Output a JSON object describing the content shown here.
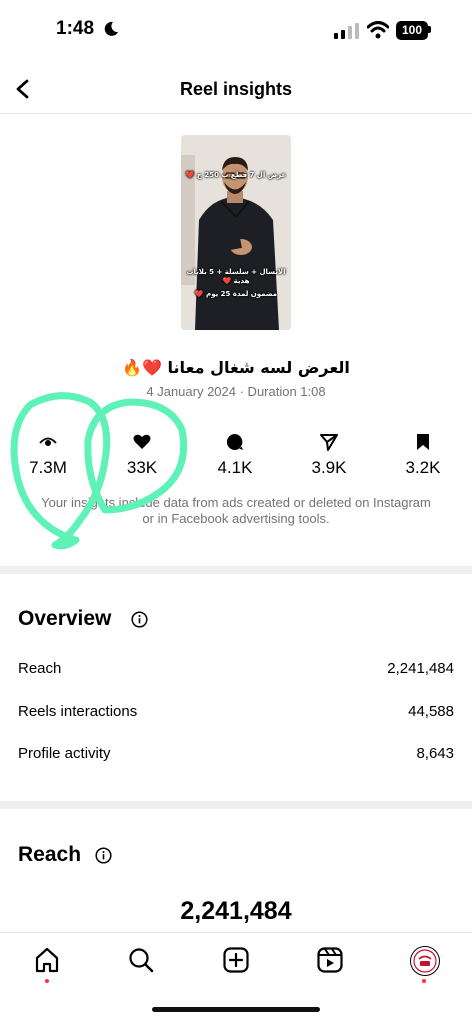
{
  "status_bar": {
    "time": "1:48",
    "battery": "100"
  },
  "header": {
    "title": "Reel insights"
  },
  "reel": {
    "thumbnail_caption_top": "عرض ال 7 قطع ب 250 ج ❤️",
    "thumbnail_caption_mid": "الانسال + سلسلة + 5 بلابات هدية ❤️",
    "thumbnail_caption_bot": "مضمون لمدة 25 يوم ❤️",
    "title": "العرض لسه شغال معانا ❤️🔥",
    "date_duration": "4 January 2024 · Duration 1:08"
  },
  "metrics": {
    "views": "7.3M",
    "likes": "33K",
    "comments": "4.1K",
    "shares": "3.9K",
    "saves": "3.2K"
  },
  "note": "Your insights include data from ads created or deleted on Instagram or in Facebook advertising tools.",
  "overview": {
    "title": "Overview",
    "rows": [
      {
        "label": "Reach",
        "value": "2,241,484"
      },
      {
        "label": "Reels interactions",
        "value": "44,588"
      },
      {
        "label": "Profile activity",
        "value": "8,643"
      }
    ]
  },
  "reach": {
    "title": "Reach",
    "value": "2,241,484"
  },
  "colors": {
    "annotation": "#5ef2b8",
    "notification_dot": "#ff3040"
  }
}
